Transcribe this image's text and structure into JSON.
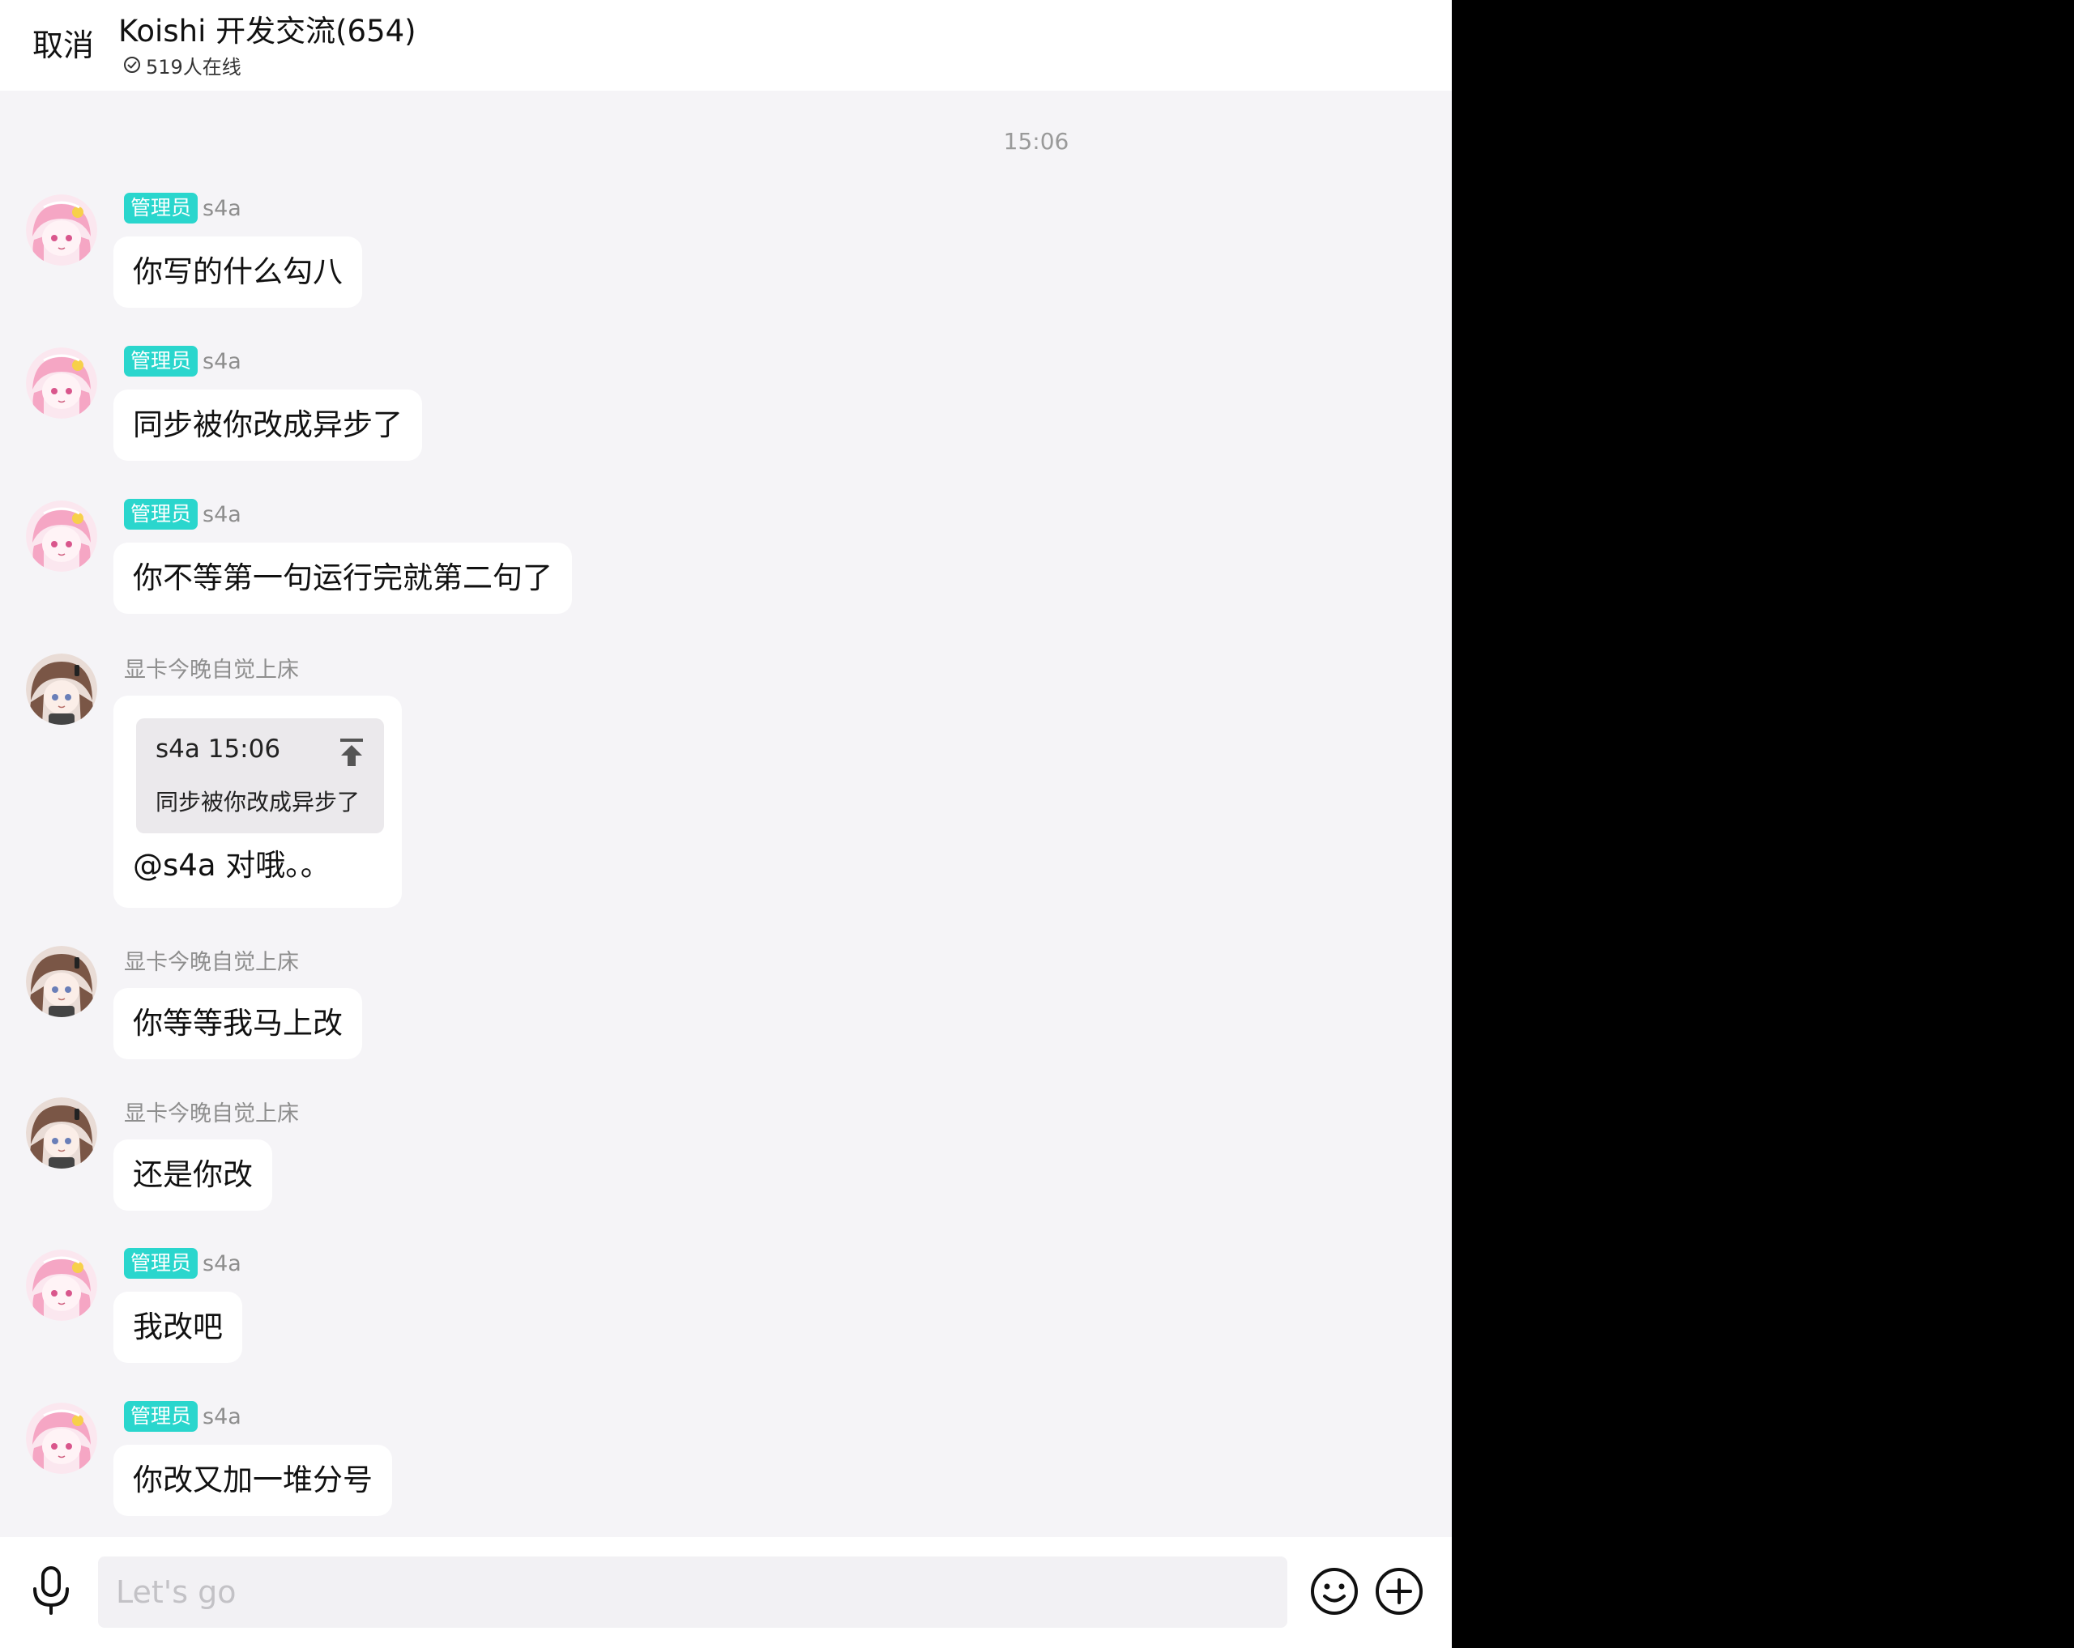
{
  "header": {
    "cancel_label": "取消",
    "title": "Koishi 开发交流(654)",
    "online_text": "519人在线"
  },
  "timestamp": "15:06",
  "messages": [
    {
      "sender": "s4a",
      "role": "管理员",
      "avatar": "pink-hair-avatar",
      "text": "你写的什么勾八"
    },
    {
      "sender": "s4a",
      "role": "管理员",
      "avatar": "pink-hair-avatar",
      "text": "同步被你改成异步了"
    },
    {
      "sender": "s4a",
      "role": "管理员",
      "avatar": "pink-hair-avatar",
      "text": "你不等第一句运行完就第二句了"
    },
    {
      "sender": "显卡今晚自觉上床",
      "role": "",
      "avatar": "brown-hair-avatar",
      "quote": {
        "meta": "s4a 15:06",
        "text": "同步被你改成异步了"
      },
      "text": "@s4a 对哦。。"
    },
    {
      "sender": "显卡今晚自觉上床",
      "role": "",
      "avatar": "brown-hair-avatar",
      "text": "你等等我马上改"
    },
    {
      "sender": "显卡今晚自觉上床",
      "role": "",
      "avatar": "brown-hair-avatar",
      "text": "还是你改"
    },
    {
      "sender": "s4a",
      "role": "管理员",
      "avatar": "pink-hair-avatar",
      "text": "我改吧"
    },
    {
      "sender": "s4a",
      "role": "管理员",
      "avatar": "pink-hair-avatar",
      "text": "你改又加一堆分号"
    }
  ],
  "input": {
    "placeholder": "Let's go",
    "value": ""
  },
  "icons": {
    "online": "check-circle-icon",
    "quote_jump": "jump-to-top-icon",
    "mic": "microphone-icon",
    "emoji": "smiley-icon",
    "plus": "plus-circle-icon"
  },
  "colors": {
    "background": "#f5f4f7",
    "bubble": "#ffffff",
    "admin_badge": "#2ad6cd",
    "text": "#111111",
    "muted": "#8e8e8e"
  }
}
